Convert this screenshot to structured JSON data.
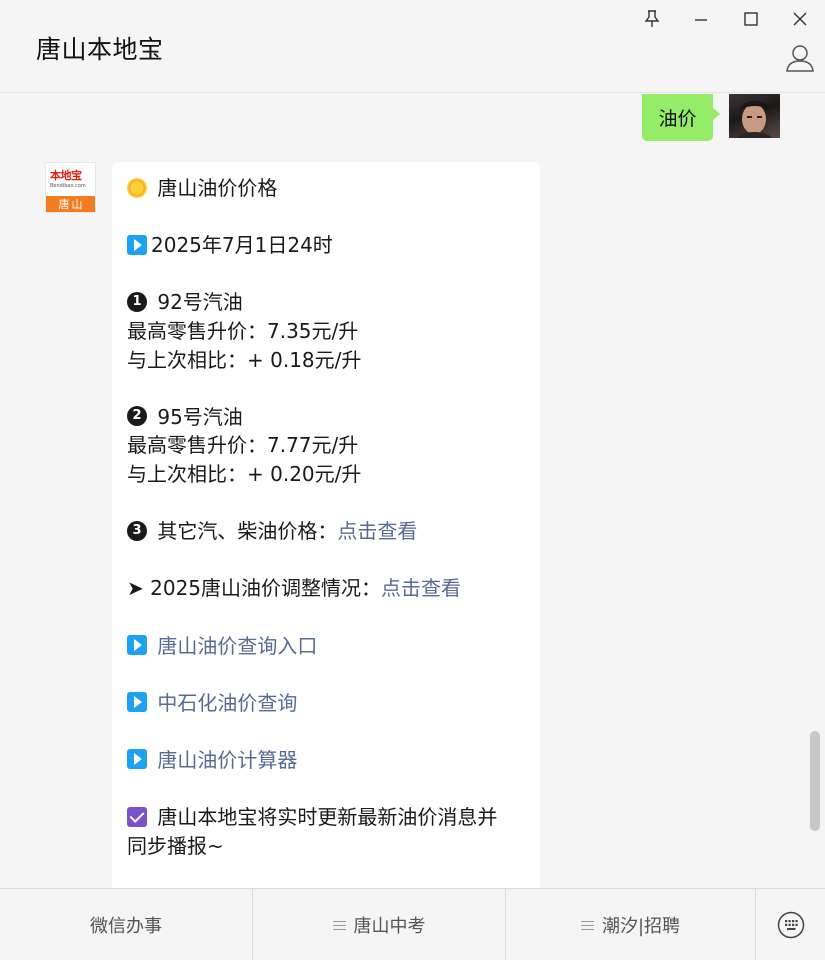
{
  "window": {
    "title": "唐山本地宝",
    "controls": [
      "pin-icon",
      "minimize-icon",
      "maximize-icon",
      "close-icon"
    ]
  },
  "chat": {
    "user_message": "油价",
    "bot_avatar": {
      "logo_text": "本地宝",
      "site_text": "Bendibao.com",
      "city_text": "唐山"
    },
    "bot_message": {
      "title": "唐山油价价格",
      "date": "2025年7月1日24时",
      "item92": {
        "num": "❶",
        "name": "92号汽油",
        "price_label": "最高零售升价：",
        "price": "7.35元/升",
        "compare_label": "与上次相比：",
        "compare": "+ 0.18元/升"
      },
      "item95": {
        "num": "❷",
        "name": "95号汽油",
        "price_label": "最高零售升价：",
        "price": "7.77元/升",
        "compare_label": "与上次相比：",
        "compare": "+ 0.20元/升"
      },
      "other": {
        "num": "❸",
        "label": "其它汽、柴油价格：",
        "link": "点击查看"
      },
      "adjust": {
        "arrow": "➤",
        "label": "2025唐山油价调整情况：",
        "link": "点击查看"
      },
      "links": [
        "唐山油价查询入口",
        "中石化油价查询",
        "唐山油价计算器"
      ],
      "notice_line1": "唐山本地宝将实时更新最新油价消息并",
      "notice_line2": "同步播报~"
    }
  },
  "menu": {
    "items": [
      "微信办事",
      "唐山中考",
      "潮汐|招聘"
    ]
  },
  "colors": {
    "user_bubble": "#95ec69",
    "link": "#576b95",
    "play_icon": "#1da1f2",
    "check_icon": "#7b52c8",
    "avatar_banner": "#f47b20"
  }
}
